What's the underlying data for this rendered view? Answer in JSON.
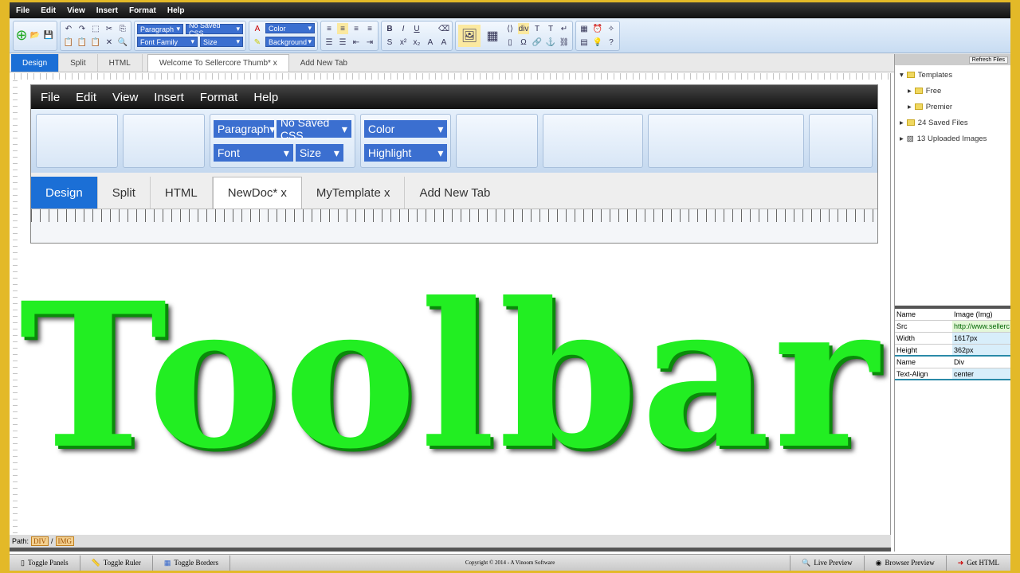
{
  "menu": [
    "File",
    "Edit",
    "View",
    "Insert",
    "Format",
    "Help"
  ],
  "toolbar": {
    "paragraph": "Paragraph",
    "saved_css": "No Saved CSS",
    "font_family": "Font Family",
    "size": "Size",
    "color": "Color",
    "background": "Background",
    "bold": "B",
    "italic": "I",
    "underline": "U",
    "div": "div"
  },
  "tabs": [
    "Design",
    "Split",
    "HTML"
  ],
  "doc_tab": "Welcome To Sellercore Thumb*",
  "close": "x",
  "add_tab": "Add New Tab",
  "right_panel": {
    "refresh": "Refresh Files",
    "tree": [
      "Templates",
      "Free",
      "Premier",
      "24 Saved Files",
      "13 Uploaded Images"
    ],
    "props": [
      [
        "Name",
        "Image (Img)"
      ],
      [
        "Src",
        "http://www.sellerc"
      ],
      [
        "Width",
        "1617px"
      ],
      [
        "Height",
        "362px"
      ],
      [
        "Name",
        "Div"
      ],
      [
        "Text-Align",
        "center"
      ]
    ]
  },
  "image": {
    "menu": [
      "File",
      "Edit",
      "View",
      "Insert",
      "Format",
      "Help"
    ],
    "paragraph": "Paragraph",
    "saved_css": "No Saved CSS",
    "font": "Font",
    "size": "Size",
    "color": "Color",
    "highlight": "Highlight",
    "tabs": [
      "Design",
      "Split",
      "HTML"
    ],
    "doc_tabs": [
      "NewDoc* x",
      "MyTemplate x"
    ],
    "add_tab": "Add New Tab",
    "big_text": "Toolbar"
  },
  "path": {
    "label": "Path:",
    "items": [
      "DIV",
      "IMG"
    ]
  },
  "bottom": {
    "toggle_panels": "Toggle Panels",
    "toggle_ruler": "Toggle Ruler",
    "toggle_borders": "Toggle Borders",
    "copyright": "Copyright © 2014 - A Vinoom Software",
    "live_preview": "Live Preview",
    "browser_preview": "Browser Preview",
    "get_html": "Get HTML"
  }
}
